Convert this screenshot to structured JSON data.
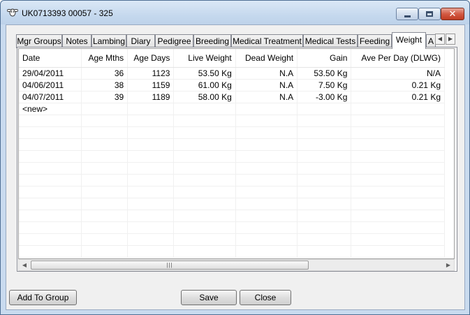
{
  "window": {
    "title": "UK0713393 00057 - 325",
    "app_icon": "sheep-head-icon"
  },
  "tabs": [
    {
      "label": "Mgr Groups"
    },
    {
      "label": "Notes"
    },
    {
      "label": "Lambing"
    },
    {
      "label": "Diary"
    },
    {
      "label": "Pedigree"
    },
    {
      "label": "Breeding"
    },
    {
      "label": "Medical Treatment"
    },
    {
      "label": "Medical Tests"
    },
    {
      "label": "Feeding"
    },
    {
      "label": "Weight",
      "active": true
    },
    {
      "label": "A"
    }
  ],
  "grid": {
    "columns": [
      "Date",
      "Age Mths",
      "Age Days",
      "Live Weight",
      "Dead Weight",
      "Gain",
      "Ave Per Day (DLWG)"
    ],
    "rows": [
      [
        "29/04/2011",
        "36",
        "1123",
        "53.50 Kg",
        "N.A",
        "53.50 Kg",
        "N/A"
      ],
      [
        "04/06/2011",
        "38",
        "1159",
        "61.00 Kg",
        "N.A",
        "7.50 Kg",
        "0.21 Kg"
      ],
      [
        "04/07/2011",
        "39",
        "1189",
        "58.00 Kg",
        "N.A",
        "-3.00 Kg",
        "0.21 Kg"
      ]
    ],
    "new_row_label": "<new>"
  },
  "buttons": {
    "add_to_group": "Add To Group",
    "save": "Save",
    "close": "Close"
  }
}
